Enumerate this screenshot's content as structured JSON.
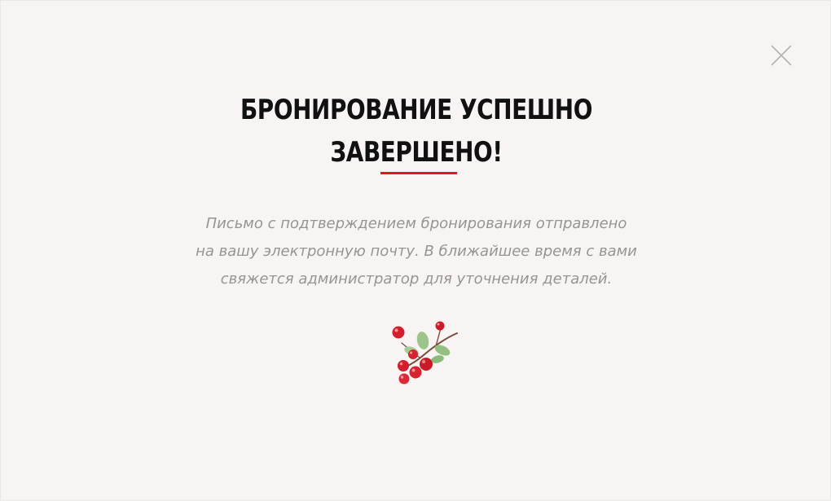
{
  "modal": {
    "title_lines": [
      "БРОНИРОВАНИЕ УСПЕШНО",
      "ЗАВЕРШЕНО!"
    ],
    "message_lines": [
      "Письмо с подтверждением бронирования отправлено",
      "на вашу электронную почту. В ближайшее время с вами",
      "свяжется администратор для уточнения деталей."
    ],
    "close_icon": "close-icon",
    "illustration": "lingonberry-branch-icon"
  },
  "colors": {
    "background": "#f7f4f3",
    "title": "#111111",
    "accent": "#e3161c",
    "message": "#999494",
    "close_icon": "#b5b1b0"
  }
}
